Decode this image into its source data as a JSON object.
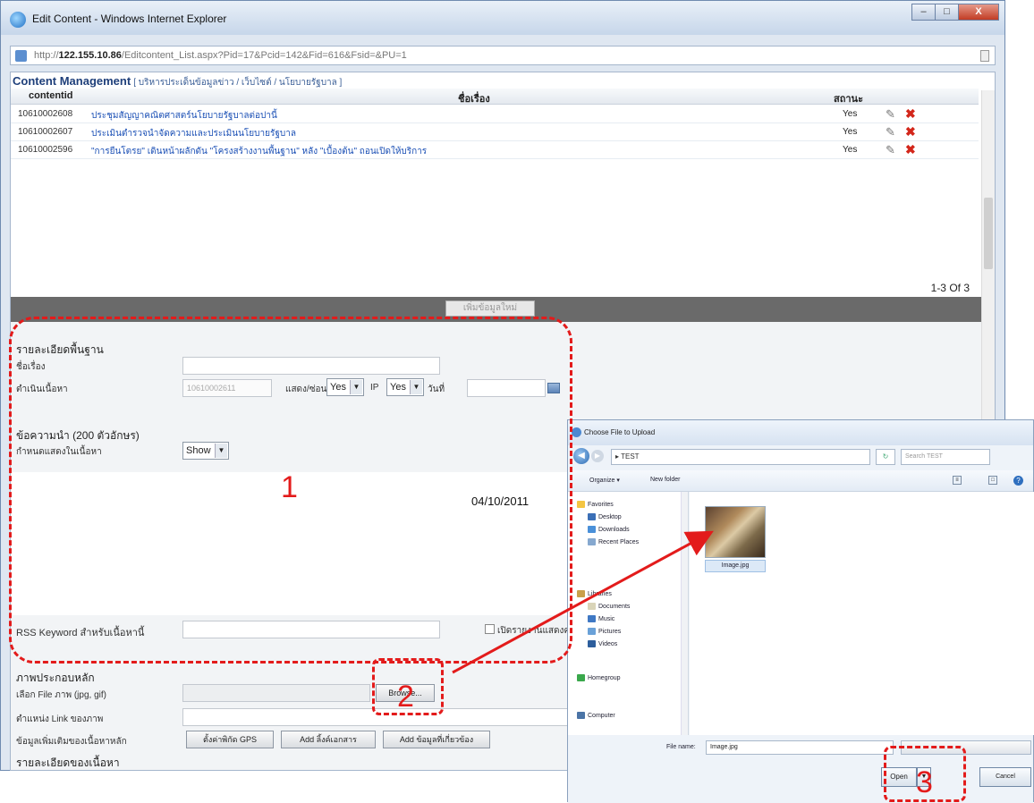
{
  "window": {
    "title": "Edit Content - Windows Internet Explorer",
    "controls": [
      "–",
      "□",
      "X"
    ],
    "address_prefix": "http://",
    "address_host": "122.155.10.86",
    "address_path": "/Editcontent_List.aspx?Pid=17&Pcid=142&Fid=616&Fsid=&PU=1"
  },
  "grid": {
    "title": "Content Management",
    "breadcrumb": "[ บริหารประเด็นข้อมูลข่าว / เว็บไซต์ / นโยบายรัฐบาล ]",
    "headers": {
      "id": "contentid",
      "name": "ชื่อเรื่อง",
      "status": "สถานะ"
    },
    "rows": [
      {
        "id": "10610002608",
        "title": "ประชุมสัญญาคณิตศาสตร์นโยบายรัฐบาลต่อปานี้",
        "status": "Yes"
      },
      {
        "id": "10610002607",
        "title": "ประเมินตำรวจนำจัดความและประเมินนโยบายรัฐบาล",
        "status": "Yes"
      },
      {
        "id": "10610002596",
        "title": "\"การยืนโตรย\" เดินหน้าผลักดัน \"โครงสร้างงานพื้นฐาน\" หลัง \"เบื้องต้น\" ถอนเปิดให้บริการ",
        "status": "Yes"
      }
    ],
    "pager": "1-3 Of 3",
    "add_button": "เพิ่มข้อมูลใหม่"
  },
  "form": {
    "section_basic": "รายละเอียดพื้นฐาน",
    "label_title": "ชื่อเรื่อง",
    "label_content_id": "ตำเนินเนื้อหา",
    "content_id_value": "10610002611",
    "label_display": "แสดง/ซ่อน",
    "display_value": "Yes",
    "label_ip": "IP",
    "ip_value": "Yes",
    "label_date": "วันที่",
    "section_summary": "ข้อความนำ (200 ตัวอักษร)",
    "label_show_in_content": "กำหนดแสดงในเนื้อหา",
    "show_value": "Show",
    "date_note": "04/10/2011",
    "label_rss": "RSS Keyword สำหรับเนื้อหานี้",
    "checkbox_label": "เปิดรายงานแสดงความเห็น",
    "section_image": "ภาพประกอบหลัก",
    "label_select_file": "เลือก File ภาพ (jpg, gif)",
    "browse_button": "Browse...",
    "label_link": "ตำแหน่ง Link ของภาพ",
    "label_related": "ข้อมูลเพิ่มเติมของเนื้อหาหลัก",
    "btn_gps": "ตั้งค่าพิกัด GPS",
    "btn_add_doc": "Add ลิ้งค์เอกสาร",
    "btn_add_related": "Add ข้อมูลที่เกี่ยวข้อง",
    "section_detail": "รายละเอียดของเนื้อหา"
  },
  "dialog": {
    "title": "Choose File to Upload",
    "path": "▸ TEST",
    "search_placeholder": "Search TEST",
    "toolbar_organize": "Organize ▾",
    "toolbar_newfolder": "New folder",
    "tree": [
      "Favorites",
      "Desktop",
      "Downloads",
      "Recent Places",
      "Libraries",
      "Documents",
      "Music",
      "Pictures",
      "Videos",
      "Homegroup",
      "Computer"
    ],
    "file_name_label": "File name:",
    "file_name_value": "Image.jpg",
    "thumbnail_caption": "Image.jpg",
    "open_button": "Open",
    "cancel_button": "Cancel"
  },
  "annotations": {
    "step1": "1",
    "step2": "2",
    "step3": "3",
    "color": "#e31b1b"
  }
}
